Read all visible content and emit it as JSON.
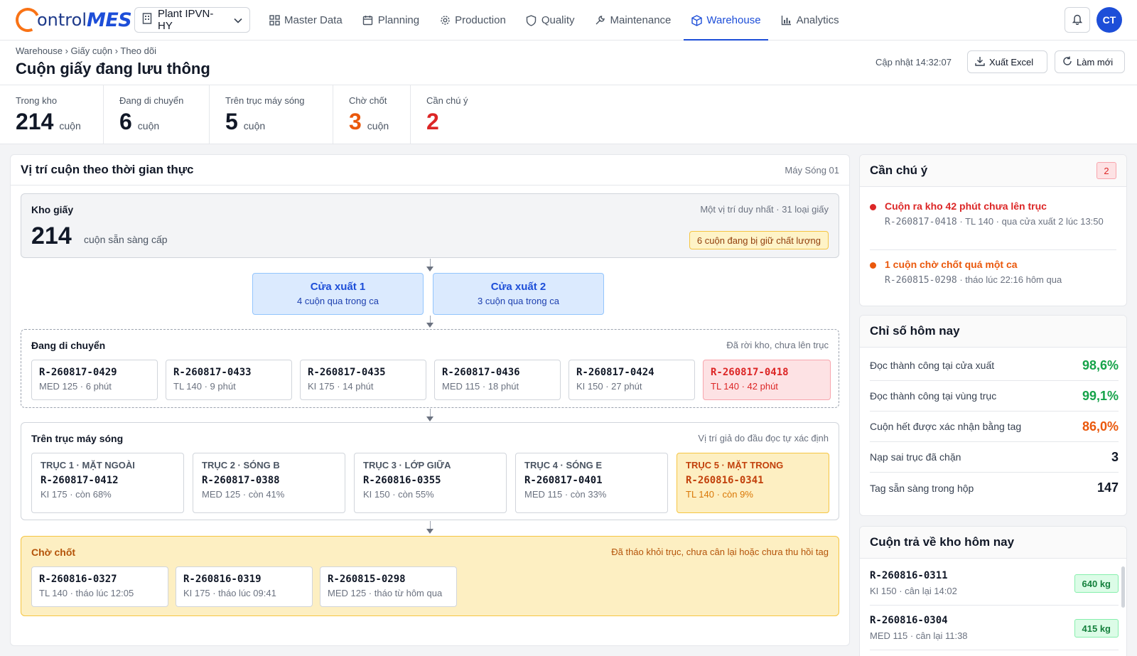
{
  "brand": {
    "part1": "ontrol",
    "part2": "MES"
  },
  "plant": {
    "label": "Plant IPVN-HY"
  },
  "nav": [
    {
      "label": "Master Data",
      "icon": "grid-icon"
    },
    {
      "label": "Planning",
      "icon": "calendar-icon"
    },
    {
      "label": "Production",
      "icon": "gear-icon"
    },
    {
      "label": "Quality",
      "icon": "shield-icon"
    },
    {
      "label": "Maintenance",
      "icon": "wrench-icon"
    },
    {
      "label": "Warehouse",
      "icon": "box-icon",
      "active": true
    },
    {
      "label": "Analytics",
      "icon": "bar-chart-icon"
    }
  ],
  "user": {
    "initials": "CT"
  },
  "header": {
    "breadcrumb": "Warehouse › Giấy cuộn › Theo dõi",
    "title": "Cuộn giấy đang lưu thông",
    "updated": "Cập nhật 14:32:07",
    "export_label": "Xuất Excel",
    "refresh_label": "Làm mới"
  },
  "kpis": [
    {
      "label": "Trong kho",
      "value": "214",
      "unit": "cuộn",
      "color": "#111827"
    },
    {
      "label": "Đang di chuyển",
      "value": "6",
      "unit": "cuộn",
      "color": "#111827"
    },
    {
      "label": "Trên trục máy sóng",
      "value": "5",
      "unit": "cuộn",
      "color": "#111827"
    },
    {
      "label": "Chờ chốt",
      "value": "3",
      "unit": "cuộn",
      "color": "#ea580c"
    },
    {
      "label": "Cần chú ý",
      "value": "2",
      "unit": "",
      "color": "#dc2626"
    }
  ],
  "main": {
    "title": "Vị trí cuộn theo thời gian thực",
    "machine": "Máy Sóng 01",
    "stock": {
      "title": "Kho giấy",
      "note": "Một vị trí duy nhất · 31 loại giấy",
      "count": "214",
      "unit": "cuộn sẵn sàng cấp",
      "hold": "6 cuộn đang bị giữ chất lượng"
    },
    "gates": [
      {
        "name": "Cửa xuất 1",
        "sub": "4 cuộn qua trong ca"
      },
      {
        "name": "Cửa xuất 2",
        "sub": "3 cuộn qua trong ca"
      }
    ],
    "moving": {
      "title": "Đang di chuyển",
      "note": "Đã rời kho, chưa lên trục",
      "rolls": [
        {
          "id": "R-260817-0429",
          "meta": "MED 125 · 6 phút"
        },
        {
          "id": "R-260817-0433",
          "meta": "TL 140 · 9 phút"
        },
        {
          "id": "R-260817-0435",
          "meta": "KI 175 · 14 phút"
        },
        {
          "id": "R-260817-0436",
          "meta": "MED 115 · 18 phút"
        },
        {
          "id": "R-260817-0424",
          "meta": "KI 150 · 27 phút"
        },
        {
          "id": "R-260817-0418",
          "meta": "TL 140 · 42 phút",
          "alert": true
        }
      ]
    },
    "shafts": {
      "title": "Trên trục máy sóng",
      "note": "Vị trí giả do đầu đọc tự xác định",
      "items": [
        {
          "name": "TRỤC 1 · MẶT NGOÀI",
          "id": "R-260817-0412",
          "meta": "KI 175 · còn 68%"
        },
        {
          "name": "TRỤC 2 · SÓNG B",
          "id": "R-260817-0388",
          "meta": "MED 125 · còn 41%"
        },
        {
          "name": "TRỤC 3 · LỚP GIỮA",
          "id": "R-260816-0355",
          "meta": "KI 150 · còn 55%"
        },
        {
          "name": "TRỤC 4 · SÓNG E",
          "id": "R-260817-0401",
          "meta": "MED 115 · còn 33%"
        },
        {
          "name": "TRỤC 5 · MẶT TRONG",
          "id": "R-260816-0341",
          "meta": "TL 140 · còn 9%",
          "warn": true
        }
      ]
    },
    "pending": {
      "title": "Chờ chốt",
      "note": "Đã tháo khỏi trục, chưa cân lại hoặc chưa thu hồi tag",
      "rolls": [
        {
          "id": "R-260816-0327",
          "meta": "TL 140 · tháo lúc 12:05"
        },
        {
          "id": "R-260816-0319",
          "meta": "KI 175 · tháo lúc 09:41"
        },
        {
          "id": "R-260815-0298",
          "meta": "MED 125 · tháo từ hôm qua"
        }
      ]
    }
  },
  "attention": {
    "title": "Cần chú ý",
    "count": "2",
    "items": [
      {
        "title": "Cuộn ra kho 42 phút chưa lên trục",
        "id": "R-260817-0418",
        "desc": " · TL 140 · qua cửa xuất 2 lúc 13:50",
        "color": "#dc2626"
      },
      {
        "title": "1 cuộn chờ chốt quá một ca",
        "id": "R-260815-0298",
        "desc": " · tháo lúc 22:16 hôm qua",
        "color": "#ea580c"
      }
    ]
  },
  "today": {
    "title": "Chỉ số hôm nay",
    "metrics": [
      {
        "label": "Đọc thành công tại cửa xuất",
        "value": "98,6%",
        "color": "#16a34a"
      },
      {
        "label": "Đọc thành công tại vùng trục",
        "value": "99,1%",
        "color": "#16a34a"
      },
      {
        "label": "Cuộn hết được xác nhận bằng tag",
        "value": "86,0%",
        "color": "#ea580c"
      },
      {
        "label": "Nạp sai trục đã chặn",
        "value": "3",
        "color": "#111827"
      },
      {
        "label": "Tag sẵn sàng trong hộp",
        "value": "147",
        "color": "#111827"
      }
    ]
  },
  "returns": {
    "title": "Cuộn trả về kho hôm nay",
    "items": [
      {
        "id": "R-260816-0311",
        "meta": "KI 150 · cân lại 14:02",
        "kg": "640 kg"
      },
      {
        "id": "R-260816-0304",
        "meta": "MED 115 · cân lại 11:38",
        "kg": "415 kg"
      }
    ]
  }
}
